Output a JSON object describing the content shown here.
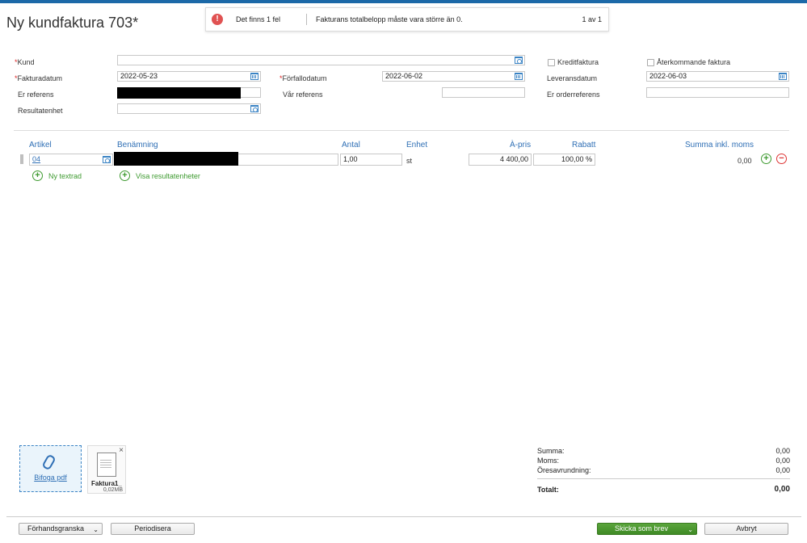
{
  "title": "Ny kundfaktura 703*",
  "error": {
    "count_text": "Det finns 1 fel",
    "message": "Fakturans totalbelopp måste vara större än 0.",
    "page": "1 av 1"
  },
  "form": {
    "kund_label": "Kund",
    "kund_value": "",
    "fakturadatum_label": "Fakturadatum",
    "fakturadatum_value": "2022-05-23",
    "forfallodatum_label": "Förfallodatum",
    "forfallodatum_value": "2022-06-02",
    "er_referens_label": "Er referens",
    "var_referens_label": "Vår referens",
    "resultatenhet_label": "Resultatenhet",
    "kreditfaktura_label": "Kreditfaktura",
    "aterkommande_label": "Återkommande faktura",
    "leveransdatum_label": "Leveransdatum",
    "leveransdatum_value": "2022-06-03",
    "er_orderreferens_label": "Er orderreferens"
  },
  "table": {
    "headers": {
      "artikel": "Artikel",
      "benamning": "Benämning",
      "antal": "Antal",
      "enhet": "Enhet",
      "apris": "À-pris",
      "rabatt": "Rabatt",
      "summa": "Summa inkl. moms"
    },
    "row": {
      "artikel": "04",
      "antal": "1,00",
      "enhet": "st",
      "apris": "4 400,00",
      "rabatt": "100,00 %",
      "summa": "0,00"
    },
    "add_textrow": "Ny textrad",
    "show_units": "Visa resultatenheter"
  },
  "attachment": {
    "attach_label": "Bifoga pdf",
    "file_name": "Faktura1_",
    "file_size": "0,02MB"
  },
  "summary": {
    "summa_label": "Summa:",
    "summa_value": "0,00",
    "moms_label": "Moms:",
    "moms_value": "0,00",
    "oresavrundning_label": "Öresavrundning:",
    "oresavrundning_value": "0,00",
    "totalt_label": "Totalt:",
    "totalt_value": "0,00"
  },
  "footer": {
    "preview": "Förhandsgranska",
    "periodize": "Periodisera",
    "send": "Skicka som brev",
    "cancel": "Avbryt"
  },
  "colors": {
    "accent": "#1c69a8",
    "link": "#2f6fb5",
    "green": "#3d9a2f",
    "error": "#e05252"
  }
}
